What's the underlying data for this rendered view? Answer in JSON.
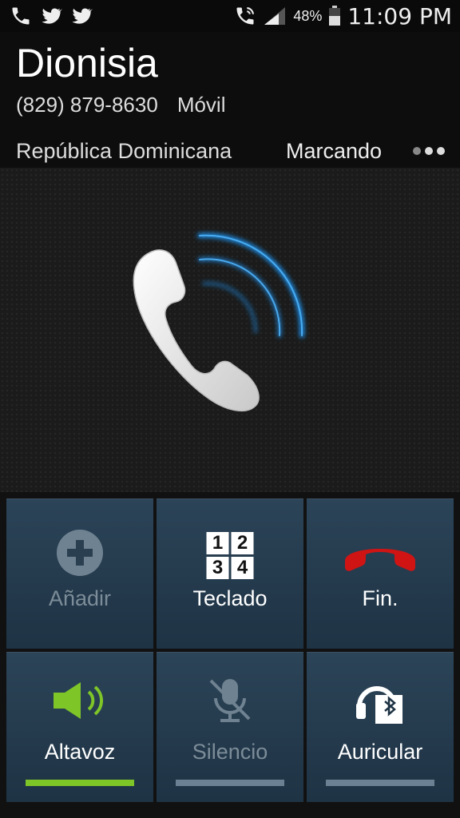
{
  "status_bar": {
    "battery": "48%",
    "time": "11:09 PM"
  },
  "contact": {
    "name": "Dionisia",
    "number": "(829) 879-8630",
    "label": "Móvil",
    "country": "República Dominicana",
    "call_status": "Marcando"
  },
  "controls": {
    "add": "Añadir",
    "keypad": "Teclado",
    "end": "Fin.",
    "speaker": "Altavoz",
    "mute": "Silencio",
    "headset": "Auricular",
    "keypad_digits": [
      "1",
      "2",
      "3",
      "4"
    ]
  },
  "colors": {
    "accent_green": "#7ec528",
    "end_red": "#d01414",
    "wave_blue": "#1e9bff"
  }
}
